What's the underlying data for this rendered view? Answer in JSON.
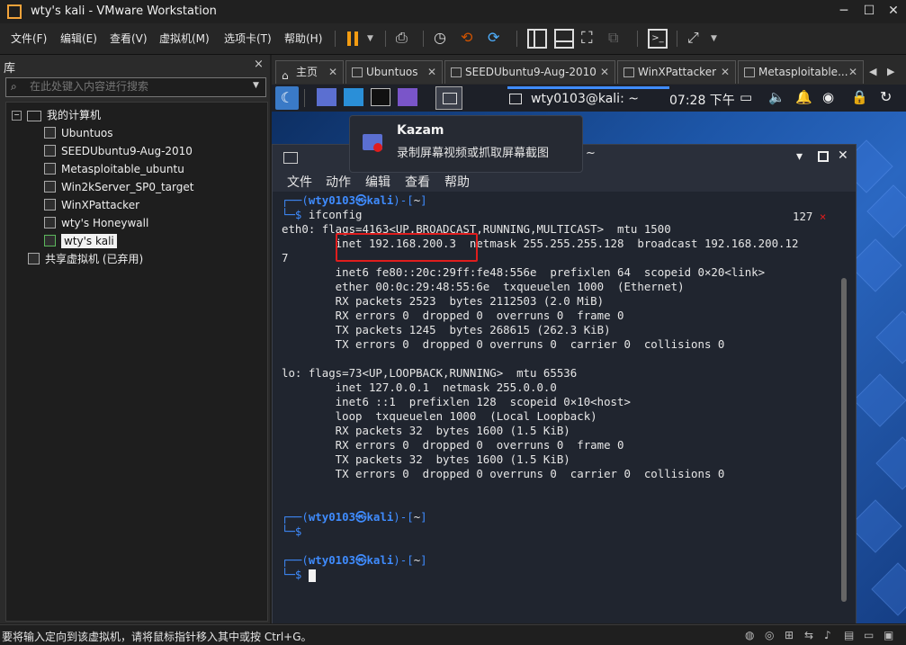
{
  "window": {
    "title": "wty's kali - VMware Workstation"
  },
  "menu": [
    "文件(F)",
    "编辑(E)",
    "查看(V)",
    "虚拟机(M)",
    "选项卡(T)",
    "帮助(H)"
  ],
  "library": {
    "header": "库",
    "close": "×",
    "search_placeholder": "在此处键入内容进行搜索",
    "root": "我的计算机",
    "vms": [
      "Ubuntuos",
      "SEEDUbuntu9-Aug-2010",
      "Metasploitable_ubuntu",
      "Win2kServer_SP0_target",
      "WinXPattacker",
      "wty's Honeywall",
      "wty's kali"
    ],
    "shared": "共享虚拟机 (已弃用)"
  },
  "tabs": [
    "主页",
    "Ubuntuos",
    "SEEDUbuntu9-Aug-2010",
    "WinXPattacker",
    "Metasploitable..."
  ],
  "kali_panel": {
    "window_title": "wty0103@kali: ~",
    "clock": "07:28 下午"
  },
  "kazam": {
    "title": "Kazam",
    "subtitle": "录制屏幕视频或抓取屏幕截图",
    "tail": "~"
  },
  "terminal": {
    "menus": [
      "文件",
      "动作",
      "编辑",
      "查看",
      "帮助"
    ],
    "user": "wty0103",
    "at": "㉿",
    "host": "kali",
    "path": "~",
    "exit_code": "127",
    "exit_mark": "×",
    "command": "ifconfig",
    "lines": [
      "eth0: flags=4163<UP,BROADCAST,RUNNING,MULTICAST>  mtu 1500",
      "        inet 192.168.200.3  netmask 255.255.255.128  broadcast 192.168.200.12",
      "7",
      "        inet6 fe80::20c:29ff:fe48:556e  prefixlen 64  scopeid 0×20<link>",
      "        ether 00:0c:29:48:55:6e  txqueuelen 1000  (Ethernet)",
      "        RX packets 2523  bytes 2112503 (2.0 MiB)",
      "        RX errors 0  dropped 0  overruns 0  frame 0",
      "        TX packets 1245  bytes 268615 (262.3 KiB)",
      "        TX errors 0  dropped 0 overruns 0  carrier 0  collisions 0",
      "",
      "lo: flags=73<UP,LOOPBACK,RUNNING>  mtu 65536",
      "        inet 127.0.0.1  netmask 255.0.0.0",
      "        inet6 ::1  prefixlen 128  scopeid 0×10<host>",
      "        loop  txqueuelen 1000  (Local Loopback)",
      "        RX packets 32  bytes 1600 (1.5 KiB)",
      "        RX errors 0  dropped 0  overruns 0  frame 0",
      "        TX packets 32  bytes 1600 (1.5 KiB)",
      "        TX errors 0  dropped 0 overruns 0  carrier 0  collisions 0"
    ]
  },
  "status": {
    "text": "要将输入定向到该虚拟机，请将鼠标指针移入其中或按 Ctrl+G。"
  },
  "colors": {
    "accent": "#3f8cff",
    "highlight_box": "#e01d1d",
    "pause": "#f39c12"
  }
}
